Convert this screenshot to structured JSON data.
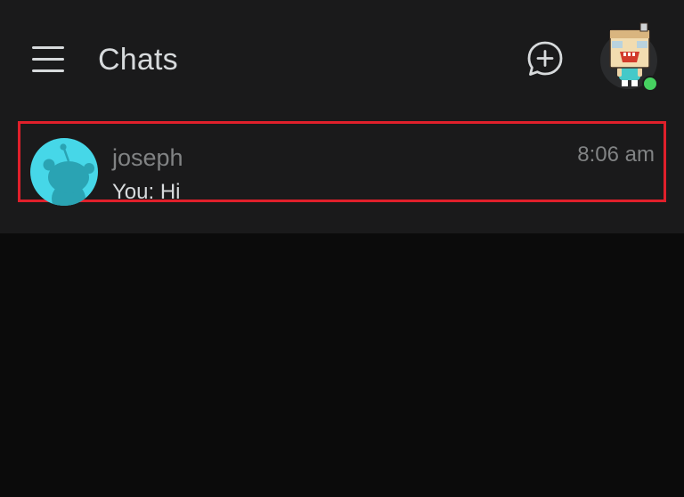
{
  "header": {
    "title": "Chats",
    "menu_icon": "hamburger-menu-icon",
    "new_chat_icon": "chat-bubble-plus-icon",
    "profile_icon": "user-avatar",
    "online_status_color": "#46d160"
  },
  "chats": [
    {
      "name": "joseph",
      "preview": "You: Hi",
      "time": "8:06 am",
      "avatar_icon": "reddit-default-avatar",
      "avatar_color": "#46d7e8",
      "highlighted": true
    }
  ],
  "colors": {
    "background": "#0b0b0b",
    "panel": "#1a1a1b",
    "text_primary": "#d7dadc",
    "text_secondary": "#818384",
    "highlight_border": "#e0202b"
  }
}
